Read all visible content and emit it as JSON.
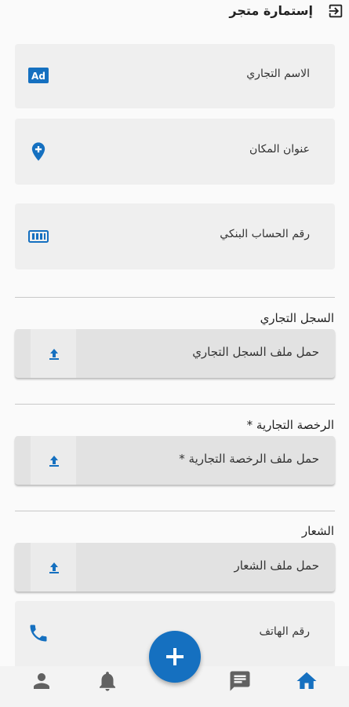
{
  "header": {
    "title": "إستمارة متجر",
    "exit_icon": "exit-icon"
  },
  "fields": {
    "trade_name": {
      "label": "الاسم التجاري",
      "icon": "ad-icon"
    },
    "address": {
      "label": "عنوان المكان",
      "icon": "location-pin-icon"
    },
    "bank_account": {
      "label": "رقم الحساب البنكي",
      "icon": "bank-account-icon"
    },
    "phone": {
      "label": "رقم الهاتف",
      "icon": "phone-icon"
    }
  },
  "sections": {
    "commercial_register": {
      "label": "السجل التجاري",
      "upload_label": "حمل ملف السجل التجاري"
    },
    "trade_license": {
      "label": "الرخصة التجارية *",
      "upload_label": "حمل ملف الرخصة التجارية *"
    },
    "logo": {
      "label": "الشعار",
      "upload_label": "حمل ملف الشعار"
    }
  },
  "bottom_nav": {
    "items": [
      "person-icon",
      "bell-icon",
      "chat-icon",
      "home-icon"
    ],
    "fab_icon": "plus-icon"
  },
  "colors": {
    "accent": "#1570c0",
    "field_bg": "#efefef",
    "upload_bg": "#e2e2e2",
    "icon_gray": "#616161"
  }
}
